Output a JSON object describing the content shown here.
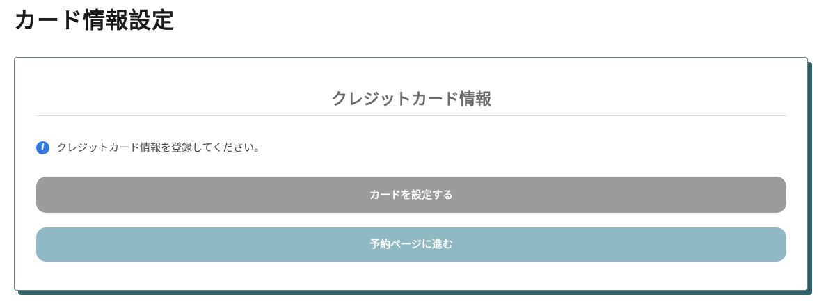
{
  "page": {
    "title": "カード情報設定"
  },
  "card": {
    "title": "クレジットカード情報",
    "info_icon": "info-icon",
    "info_text": "クレジットカード情報を登録してください。",
    "set_card_button": "カードを設定する",
    "reserve_button": "予約ページに進む"
  },
  "colors": {
    "set_card_button_bg": "#9b9b9b",
    "reserve_button_bg": "#8fbac3",
    "card_shadow": "#2f6268",
    "info_icon_bg": "#2f78e0"
  }
}
